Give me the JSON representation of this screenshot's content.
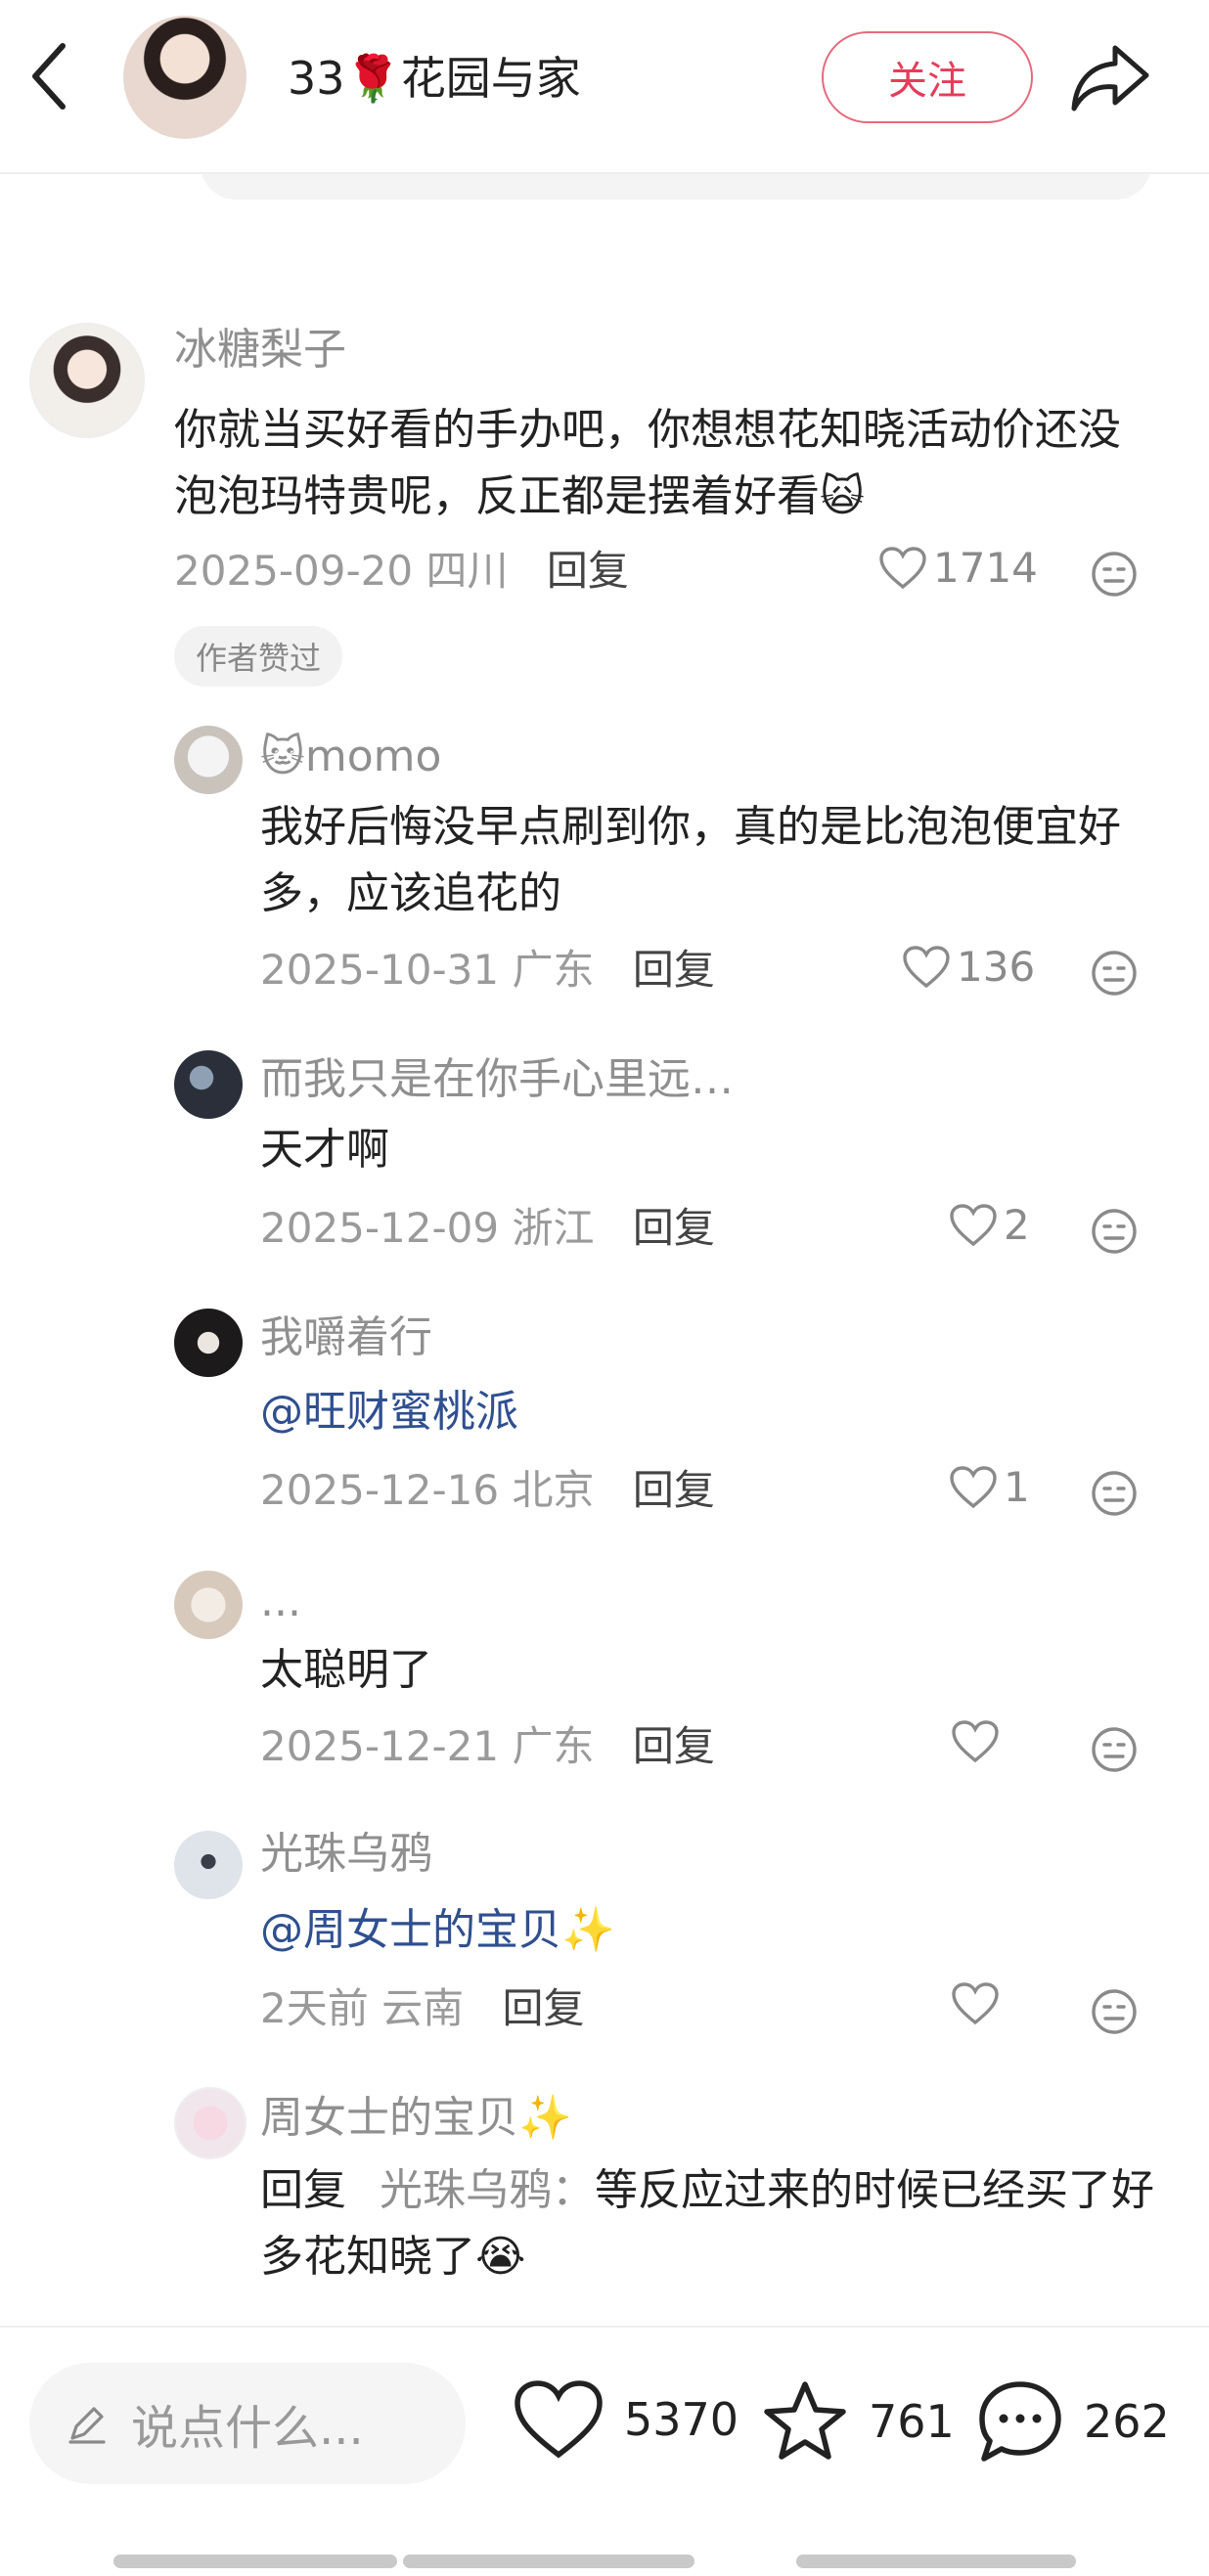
{
  "header": {
    "title": "33🌹花园与家",
    "follow_label": "关注"
  },
  "colors": {
    "accent": "#e53d5b",
    "mention": "#2f4f8f",
    "muted": "#8f8f8f"
  },
  "comments": [
    {
      "user": "冰糖梨子",
      "content": "你就当买好看的手办吧，你想想花知晓活动价还没泡泡玛特贵呢，反正都是摆着好看🙀",
      "date": "2025-09-20",
      "region": "四川",
      "reply_label": "回复",
      "likes": "1714",
      "badge": "作者赞过"
    },
    {
      "user": "🐱momo",
      "content": "我好后悔没早点刷到你，真的是比泡泡便宜好多，应该追花的",
      "date": "2025-10-31",
      "region": "广东",
      "reply_label": "回复",
      "likes": "136"
    },
    {
      "user": "而我只是在你手心里远…",
      "content": "天才啊",
      "date": "2025-12-09",
      "region": "浙江",
      "reply_label": "回复",
      "likes": "2"
    },
    {
      "user": "我嚼着行",
      "content": "@旺财蜜桃派",
      "date": "2025-12-16",
      "region": "北京",
      "reply_label": "回复",
      "likes": "1"
    },
    {
      "user": "...",
      "content": "太聪明了",
      "date": "2025-12-21",
      "region": "广东",
      "reply_label": "回复",
      "likes": ""
    },
    {
      "user": "光珠乌鸦",
      "content": "@周女士的宝贝✨",
      "date": "2天前",
      "region": "云南",
      "reply_label": "回复",
      "likes": ""
    },
    {
      "user": "周女士的宝贝✨",
      "reply_prefix": "回复",
      "reply_target": "光珠乌鸦：",
      "content": "等反应过来的时候已经买了好多花知晓了😭"
    }
  ],
  "bottom_bar": {
    "input_placeholder": "说点什么...",
    "likes": "5370",
    "favorites": "761",
    "comments": "262"
  }
}
